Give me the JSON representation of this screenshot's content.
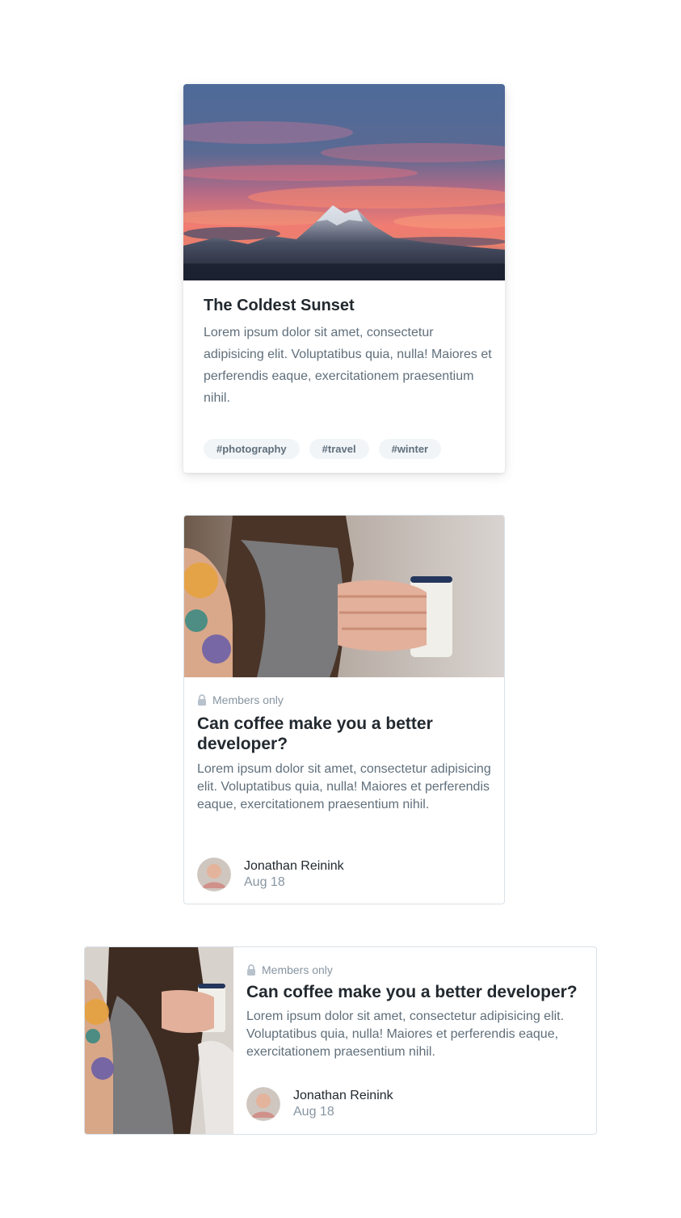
{
  "cards": [
    {
      "image_alt": "sunset-mountain-photo",
      "title": "The Coldest Sunset",
      "body": "Lorem ipsum dolor sit amet, consectetur adipisicing elit. Voluptatibus quia, nulla! Maiores et perferendis eaque, exercitationem praesentium nihil.",
      "tags": [
        "#photography",
        "#travel",
        "#winter"
      ]
    },
    {
      "image_alt": "woman-holding-coffee-mug-photo",
      "badge": "Members only",
      "title": "Can coffee make you a better developer?",
      "body": "Lorem ipsum dolor sit amet, consectetur adipisicing elit. Voluptatibus quia, nulla! Maiores et perferendis eaque, exercitationem praesentium nihil.",
      "author": {
        "name": "Jonathan Reinink",
        "date": "Aug 18"
      }
    },
    {
      "image_alt": "woman-holding-coffee-mug-photo",
      "badge": "Members only",
      "title": "Can coffee make you a better developer?",
      "body": "Lorem ipsum dolor sit amet, consectetur adipisicing elit. Voluptatibus quia, nulla! Maiores et perferendis eaque, exercitationem praesentium nihil.",
      "author": {
        "name": "Jonathan Reinink",
        "date": "Aug 18"
      }
    }
  ],
  "colors": {
    "heading": "#22292f",
    "body_text": "#606f7b",
    "muted": "#8795a1",
    "tag_bg": "#f1f5f8",
    "border": "#dae1e7"
  },
  "icons": {
    "members_badge": "lock-icon"
  }
}
